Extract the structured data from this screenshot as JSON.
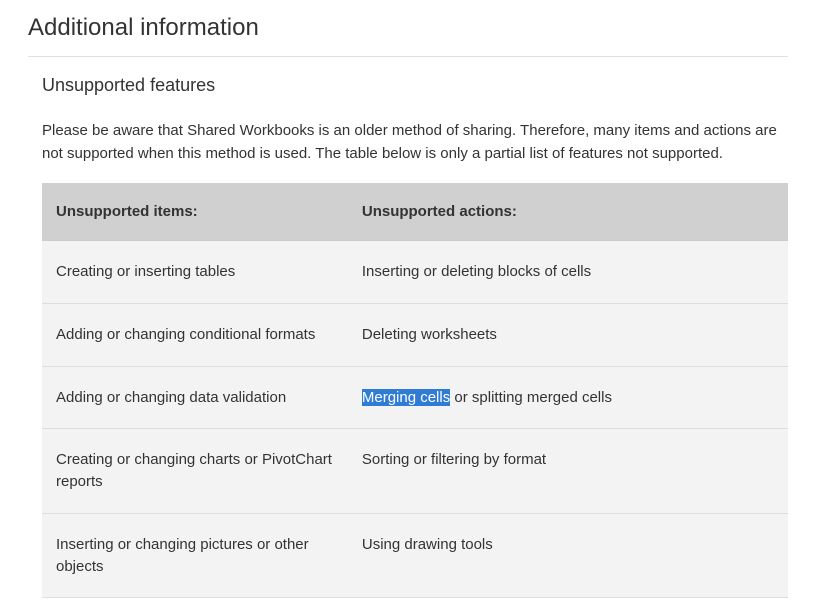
{
  "heading": "Additional information",
  "subheading": "Unsupported features",
  "intro": "Please be aware that Shared Workbooks is an older method of sharing. Therefore, many items and actions are not supported when this method is used. The table below is only a partial list of features not supported.",
  "table": {
    "headers": {
      "col1": "Unsupported items:",
      "col2": "Unsupported actions:"
    },
    "rows": [
      {
        "item": "Creating or inserting tables",
        "action": "Inserting or deleting blocks of cells"
      },
      {
        "item": "Adding or changing conditional formats",
        "action": "Deleting worksheets"
      },
      {
        "item": "Adding or changing data validation",
        "action_highlight": "Merging cells",
        "action_rest": " or splitting merged cells"
      },
      {
        "item": "Creating or changing charts or PivotChart reports",
        "action": "Sorting or filtering by format"
      },
      {
        "item": "Inserting or changing pictures or other objects",
        "action": "Using drawing tools"
      }
    ]
  }
}
